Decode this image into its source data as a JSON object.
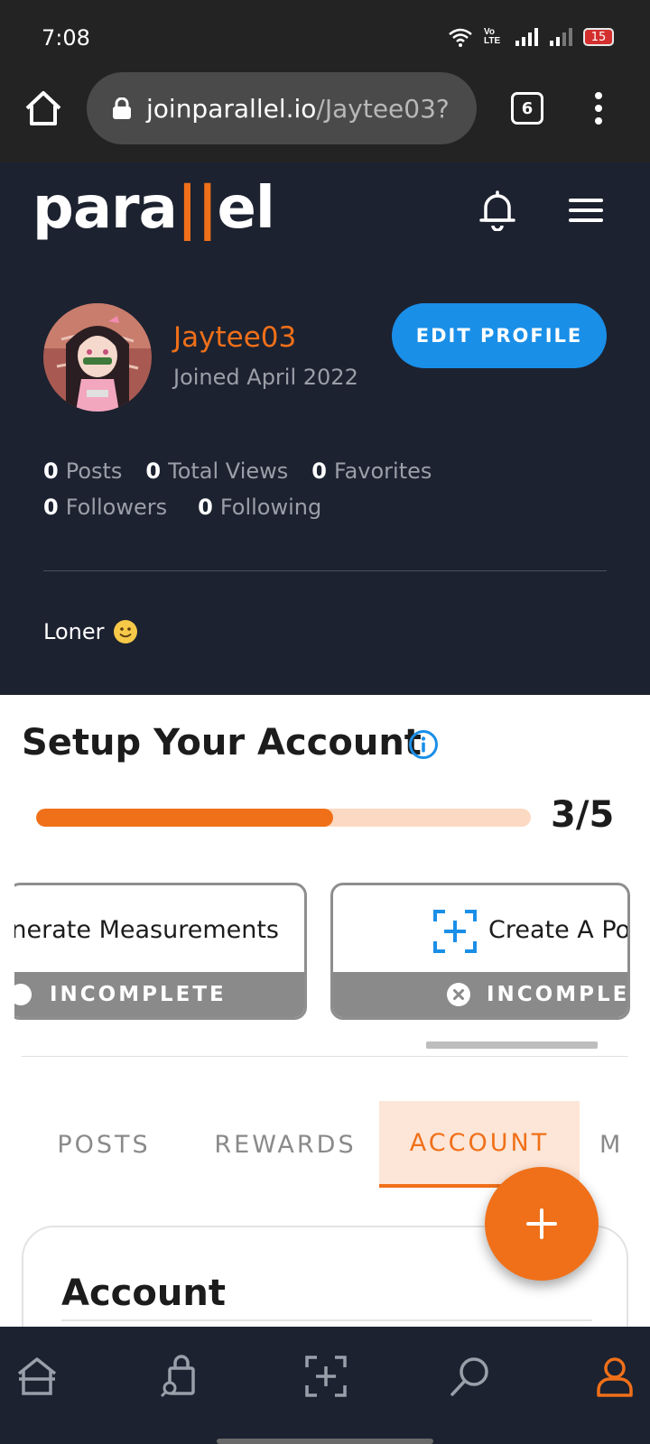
{
  "status_bar": {
    "time": "7:08",
    "battery": "15",
    "network_label": "Vo LTE"
  },
  "browser": {
    "url_domain": "joinparallel.io",
    "url_path": "/Jaytee03?",
    "tab_count": "6"
  },
  "header": {
    "logo_left": "para",
    "logo_bar": "||",
    "logo_right": "el"
  },
  "profile": {
    "username": "Jaytee03",
    "joined": "Joined April 2022",
    "edit_label": "EDIT PROFILE",
    "stats_row1": [
      {
        "num": "0",
        "label": "Posts"
      },
      {
        "num": "0",
        "label": "Total Views"
      },
      {
        "num": "0",
        "label": "Favorites"
      }
    ],
    "stats_row2": [
      {
        "num": "0",
        "label": "Followers"
      },
      {
        "num": "0",
        "label": "Following"
      }
    ],
    "bio": "Loner"
  },
  "setup": {
    "title": "Setup Your Account",
    "progress_text": "3/5",
    "progress_fraction": 0.6,
    "tasks": [
      {
        "label": "nerate Measurements",
        "status": "INCOMPLETE"
      },
      {
        "label": "Create A Po",
        "status": "INCOMPLET"
      }
    ]
  },
  "tabs": [
    "POSTS",
    "REWARDS",
    "ACCOUNT",
    "M"
  ],
  "active_tab": "ACCOUNT",
  "account": {
    "title": "Account"
  },
  "colors": {
    "accent": "#f07019",
    "header_bg": "#1c2230",
    "edit_button": "#1a8fe8"
  }
}
